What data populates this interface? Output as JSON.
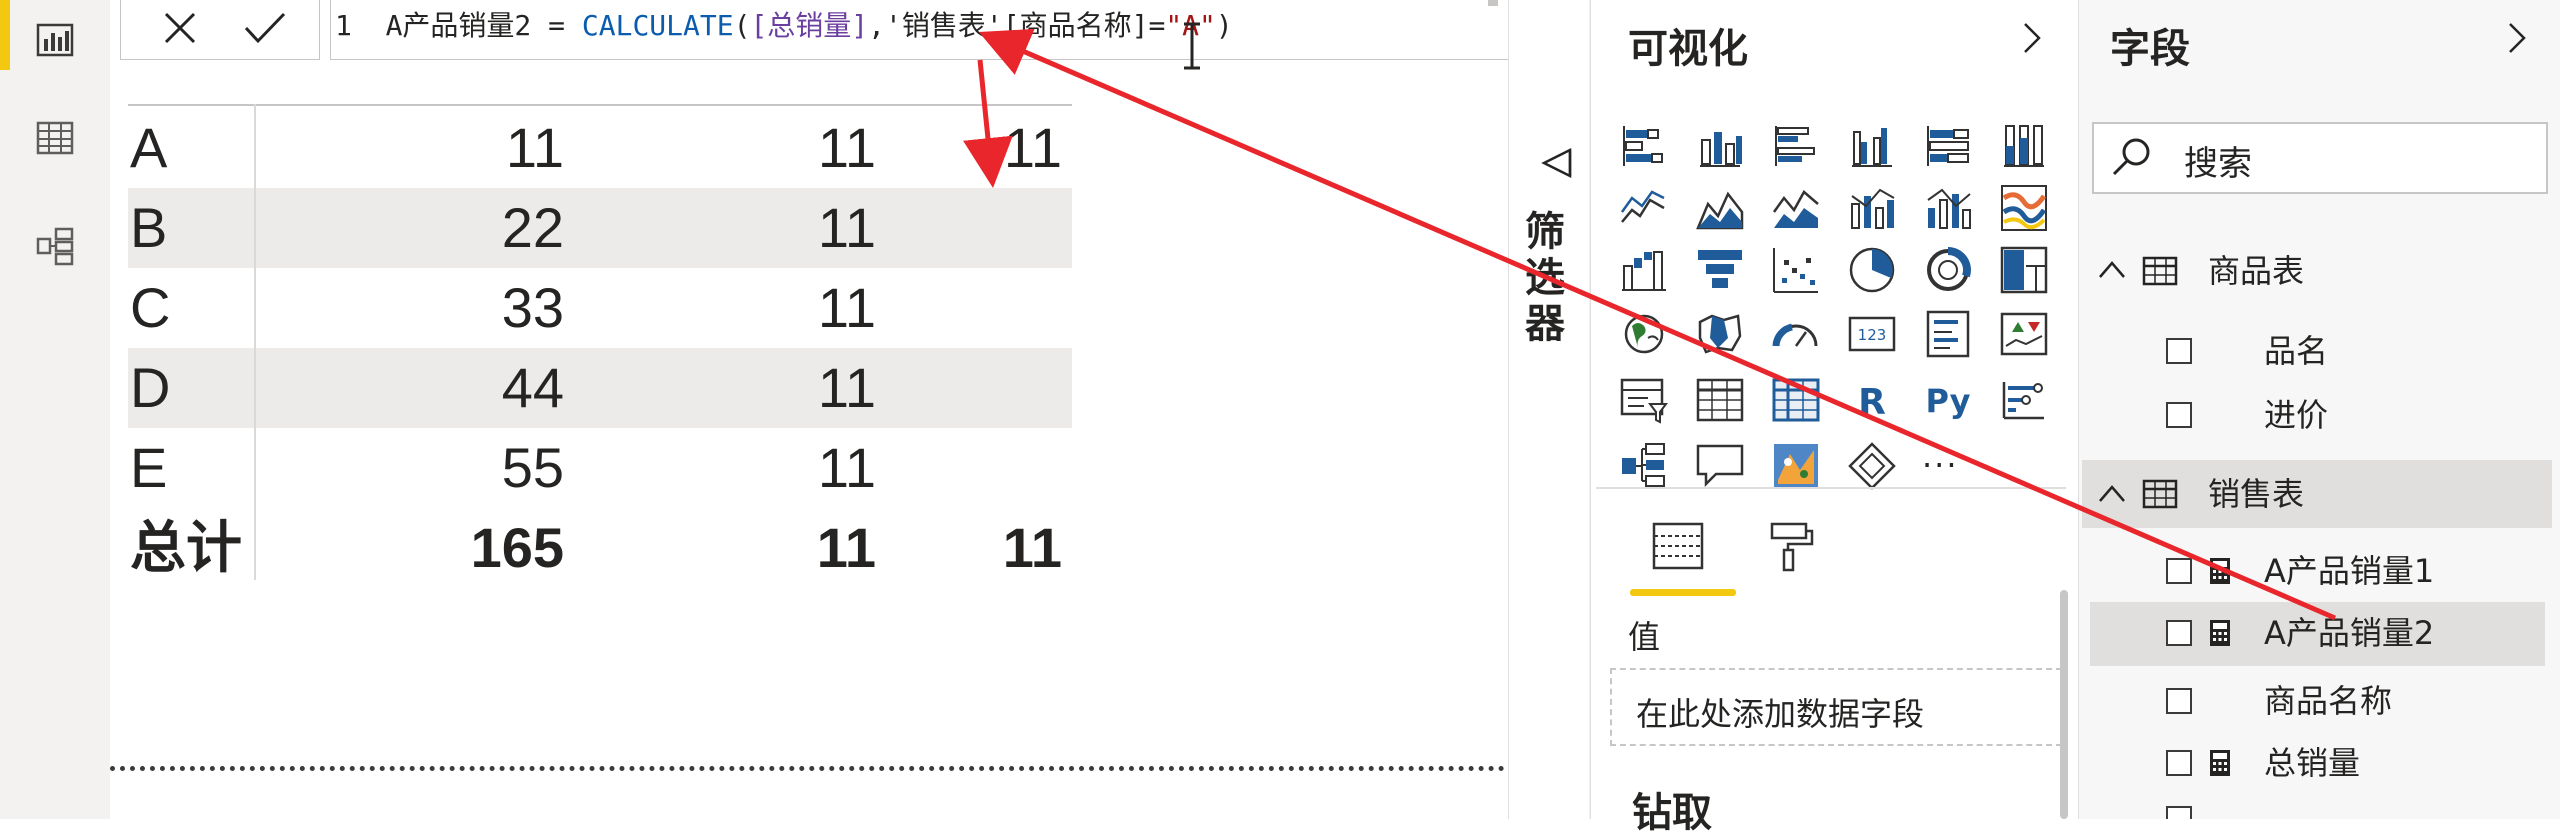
{
  "formula_bar": {
    "cancel_icon": "close-icon",
    "commit_icon": "checkmark-icon",
    "line_number": "1",
    "tokens": [
      {
        "text": "1  A产品销量2 = ",
        "kind": "plain"
      },
      {
        "text": "CALCULATE",
        "kind": "fn"
      },
      {
        "text": "(",
        "kind": "plain"
      },
      {
        "text": "[总销量]",
        "kind": "meas"
      },
      {
        "text": ",'销售表'[商品名称]=",
        "kind": "plain"
      },
      {
        "text": "\"A\"",
        "kind": "str"
      },
      {
        "text": ")",
        "kind": "plain"
      }
    ]
  },
  "matrix": {
    "rows": [
      {
        "label": "A",
        "v1": "11",
        "v2": "11",
        "v3": "11"
      },
      {
        "label": "B",
        "v1": "22",
        "v2": "11",
        "v3": ""
      },
      {
        "label": "C",
        "v1": "33",
        "v2": "11",
        "v3": ""
      },
      {
        "label": "D",
        "v1": "44",
        "v2": "11",
        "v3": ""
      },
      {
        "label": "E",
        "v1": "55",
        "v2": "11",
        "v3": ""
      }
    ],
    "total": {
      "label": "总计",
      "v1": "165",
      "v2": "11",
      "v3": "11"
    }
  },
  "filters": {
    "label": "筛选器"
  },
  "visualizations": {
    "title": "可视化",
    "values_label": "值",
    "values_placeholder": "在此处添加数据字段",
    "drill_label": "钻取",
    "more_label": "···"
  },
  "fields": {
    "title": "字段",
    "search_placeholder": "搜索",
    "tables": [
      {
        "name": "商品表",
        "fields": [
          {
            "name": "品名",
            "calc": false
          },
          {
            "name": "进价",
            "calc": false
          }
        ]
      },
      {
        "name": "销售表",
        "fields": [
          {
            "name": "A产品销量1",
            "calc": true
          },
          {
            "name": "A产品销量2",
            "calc": true
          },
          {
            "name": "商品名称",
            "calc": false
          },
          {
            "name": "总销量",
            "calc": true
          }
        ]
      }
    ]
  },
  "colors": {
    "accent": "#f2c811",
    "annotation": "#e8262b",
    "selection": "#e1dfdd"
  }
}
